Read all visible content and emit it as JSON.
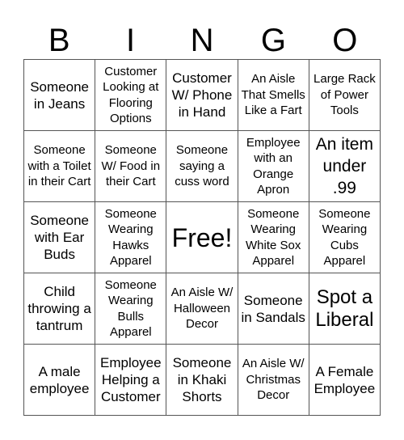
{
  "card": {
    "header": [
      "B",
      "I",
      "N",
      "G",
      "O"
    ],
    "cells": [
      {
        "text": "Someone in Jeans",
        "size": "md"
      },
      {
        "text": "Customer Looking at Flooring Options",
        "size": "sm"
      },
      {
        "text": "Customer W/ Phone in Hand",
        "size": "md"
      },
      {
        "text": "An Aisle That Smells Like a Fart",
        "size": "sm"
      },
      {
        "text": "Large Rack of Power Tools",
        "size": "sm"
      },
      {
        "text": "Someone with a Toilet in their Cart",
        "size": "sm"
      },
      {
        "text": "Someone W/ Food in their Cart",
        "size": "sm"
      },
      {
        "text": "Someone saying a cuss word",
        "size": "sm"
      },
      {
        "text": "Employee with an Orange Apron",
        "size": "sm"
      },
      {
        "text": "An item under .99",
        "size": "lg"
      },
      {
        "text": "Someone with Ear Buds",
        "size": "md"
      },
      {
        "text": "Someone Wearing Hawks Apparel",
        "size": "sm"
      },
      {
        "text": "Free!",
        "size": "free"
      },
      {
        "text": "Someone Wearing White Sox Apparel",
        "size": "sm"
      },
      {
        "text": "Someone Wearing Cubs Apparel",
        "size": "sm"
      },
      {
        "text": "Child throwing a tantrum",
        "size": "md"
      },
      {
        "text": "Someone Wearing Bulls Apparel",
        "size": "sm"
      },
      {
        "text": "An Aisle W/ Halloween Decor",
        "size": "sm"
      },
      {
        "text": "Someone in Sandals",
        "size": "md"
      },
      {
        "text": "Spot a Liberal",
        "size": "xl"
      },
      {
        "text": "A male employee",
        "size": "md"
      },
      {
        "text": "Employee Helping a Customer",
        "size": "md"
      },
      {
        "text": "Someone in Khaki Shorts",
        "size": "md"
      },
      {
        "text": "An Aisle W/ Christmas Decor",
        "size": "sm"
      },
      {
        "text": "A Female Employee",
        "size": "md"
      }
    ]
  }
}
